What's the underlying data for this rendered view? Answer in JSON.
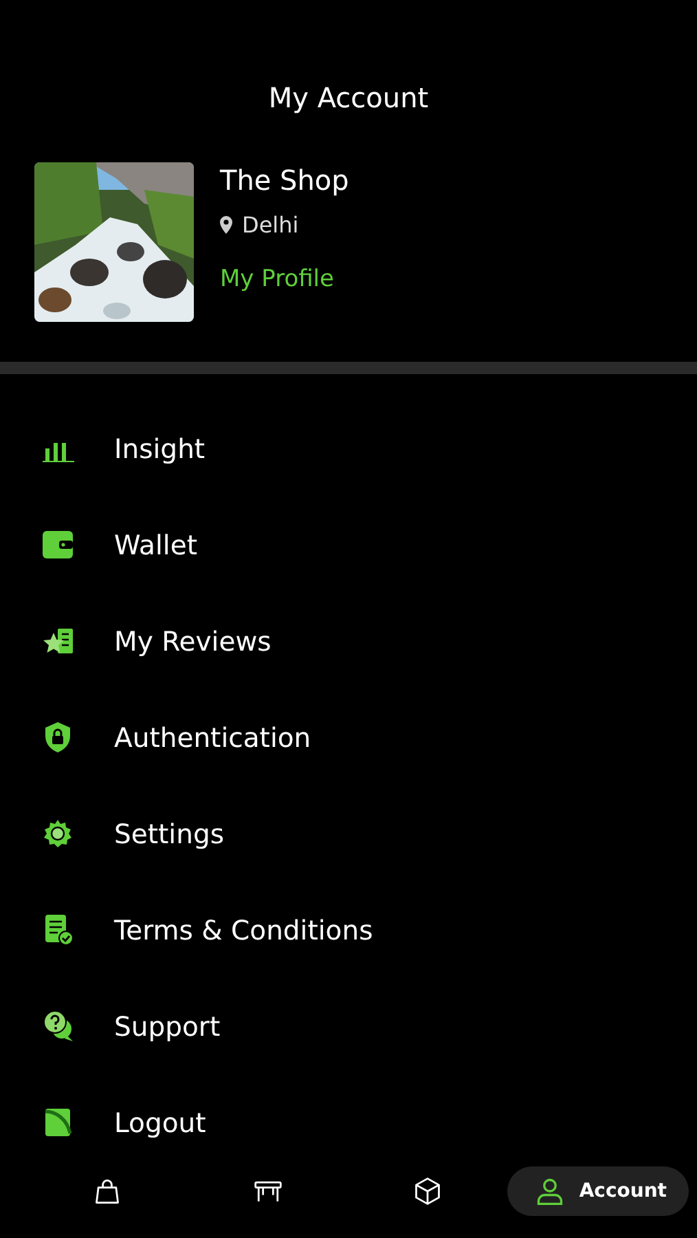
{
  "header": {
    "title": "My Account"
  },
  "profile": {
    "name": "The Shop",
    "location": "Delhi",
    "link": "My Profile"
  },
  "menu": [
    {
      "label": "Insight"
    },
    {
      "label": "Wallet"
    },
    {
      "label": "My Reviews"
    },
    {
      "label": "Authentication"
    },
    {
      "label": "Settings"
    },
    {
      "label": "Terms & Conditions"
    },
    {
      "label": "Support"
    },
    {
      "label": "Logout"
    }
  ],
  "bottom_nav": [
    {
      "selected": false
    },
    {
      "selected": false
    },
    {
      "selected": false
    },
    {
      "label": "Account",
      "selected": true
    }
  ]
}
